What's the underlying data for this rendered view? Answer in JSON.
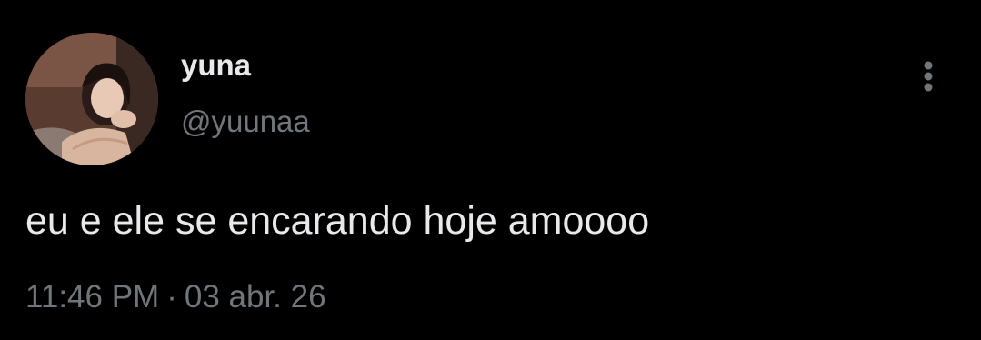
{
  "tweet": {
    "author": {
      "display_name": "yuna",
      "handle": "@yuunaa",
      "avatar": "profile-photo"
    },
    "text": "eu e ele se encarando hoje amoooo",
    "time": "11:46 PM",
    "separator": "·",
    "date": "03 abr. 26",
    "menu_icon": "more-vertical-icon"
  },
  "colors": {
    "background": "#000000",
    "primary_text": "#e7e9ea",
    "secondary_text": "#71767b"
  }
}
